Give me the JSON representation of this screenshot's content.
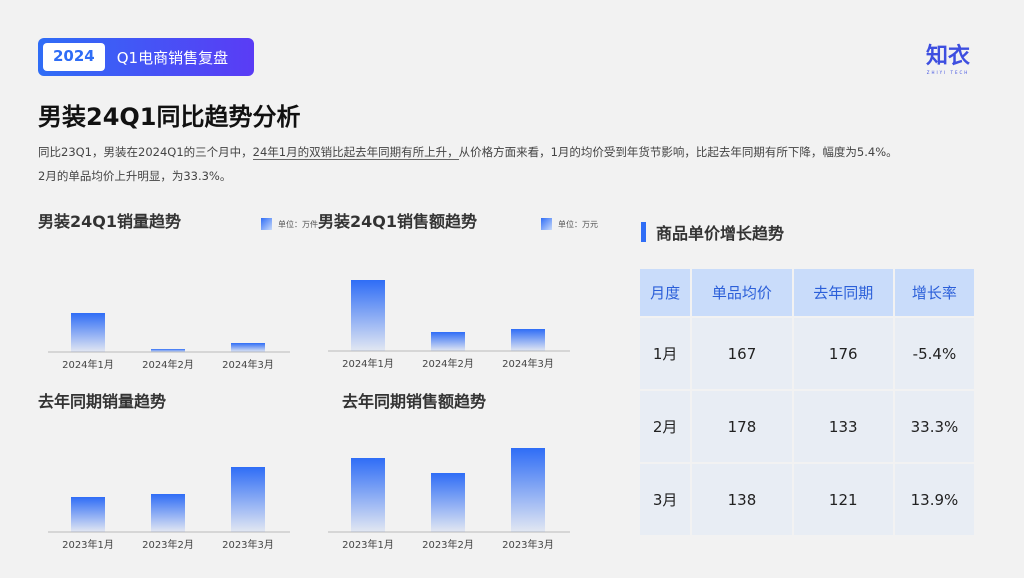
{
  "header": {
    "year": "2024",
    "title": "Q1电商销售复盘",
    "logo": "知衣",
    "logo_sub": "ZHIYI TECH"
  },
  "page_title": "男装24Q1同比趋势分析",
  "description": {
    "part1": "同比23Q1，男装在2024Q1的三个月中，",
    "highlight": "24年1月的双销比起去年同期有所上升，",
    "part2": "从价格方面来看，1月的均价受到年货节影响，比起去年同期有所下降，幅度为5.4%。",
    "line2": "2月的单品均价上升明显，为33.3%。"
  },
  "chart_data": [
    {
      "type": "bar",
      "title": "男装24Q1销量趋势",
      "unit": "单位：万件",
      "categories": [
        "2024年1月",
        "2024年2月",
        "2024年3月"
      ],
      "values": [
        39,
        3,
        9
      ],
      "note": "relative estimate, no axis"
    },
    {
      "type": "bar",
      "title": "男装24Q1销售额趋势",
      "unit": "单位：万元",
      "categories": [
        "2024年1月",
        "2024年2月",
        "2024年3月"
      ],
      "values": [
        71,
        19,
        22
      ],
      "note": "relative estimate, no axis"
    },
    {
      "type": "bar",
      "title": "去年同期销量趋势",
      "categories": [
        "2023年1月",
        "2023年2月",
        "2023年3月"
      ],
      "values": [
        35,
        38,
        65
      ],
      "note": "relative estimate, no axis"
    },
    {
      "type": "bar",
      "title": "去年同期销售额趋势",
      "categories": [
        "2023年1月",
        "2023年2月",
        "2023年3月"
      ],
      "values": [
        74,
        59,
        84
      ],
      "note": "relative estimate, no axis"
    }
  ],
  "table": {
    "title": "商品单价增长趋势",
    "headers": [
      "月度",
      "单品均价",
      "去年同期",
      "增长率"
    ],
    "rows": [
      [
        "1月",
        "167",
        "176",
        "-5.4%"
      ],
      [
        "2月",
        "178",
        "133",
        "33.3%"
      ],
      [
        "3月",
        "138",
        "121",
        "13.9%"
      ]
    ]
  },
  "colors": {
    "accent": "#2f6df6"
  }
}
